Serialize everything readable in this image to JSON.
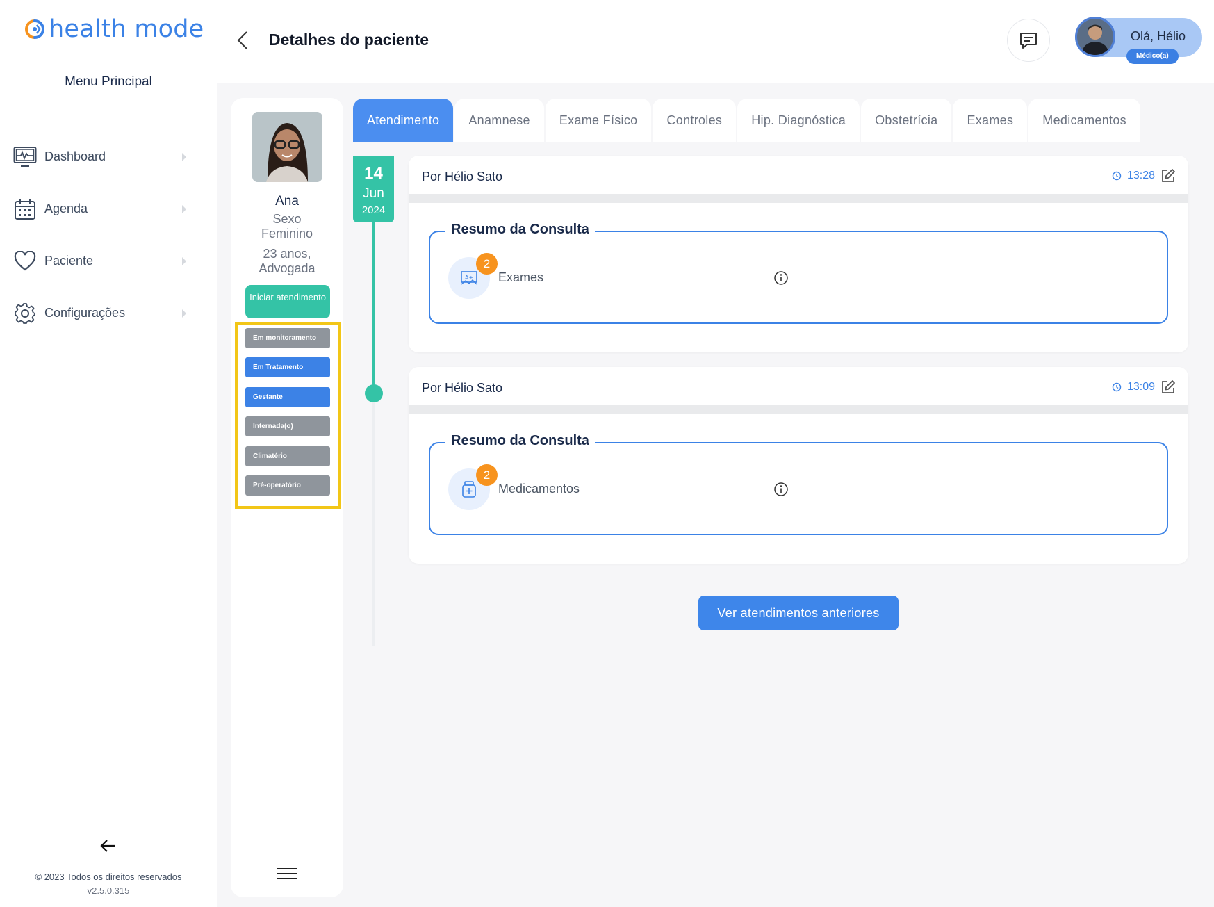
{
  "brand": {
    "logo_text": "health mode",
    "accent": "#3b82e6",
    "teal": "#34c3a6",
    "highlight": "#f2c617"
  },
  "sidebar": {
    "menu_title": "Menu Principal",
    "items": [
      {
        "label": "Dashboard",
        "icon": "monitor-pulse-icon"
      },
      {
        "label": "Agenda",
        "icon": "calendar-icon"
      },
      {
        "label": "Paciente",
        "icon": "heart-icon"
      },
      {
        "label": "Configurações",
        "icon": "gear-icon"
      }
    ],
    "footer_copyright": "© 2023 Todos os direitos reservados",
    "footer_version": "v2.5.0.315"
  },
  "header": {
    "title": "Detalhes do paciente",
    "user_greeting": "Olá, Hélio",
    "user_role": "Médico(a)"
  },
  "patient": {
    "name": "Ana",
    "sex_label": "Sexo",
    "sex_value": "Feminino",
    "age": "23 anos,",
    "profession": "Advogada",
    "start_button": "Iniciar atendimento",
    "tags": [
      {
        "label": "Em monitoramento",
        "active": false
      },
      {
        "label": "Em Tratamento",
        "active": true
      },
      {
        "label": "Gestante",
        "active": true
      },
      {
        "label": "Internada(o)",
        "active": false
      },
      {
        "label": "Climatério",
        "active": false
      },
      {
        "label": "Pré-operatório",
        "active": false
      }
    ]
  },
  "tabs": [
    {
      "label": "Atendimento",
      "active": true
    },
    {
      "label": "Anamnese",
      "active": false
    },
    {
      "label": "Exame Físico",
      "active": false
    },
    {
      "label": "Controles",
      "active": false
    },
    {
      "label": "Hip. Diagnóstica",
      "active": false
    },
    {
      "label": "Obstetrícia",
      "active": false
    },
    {
      "label": "Exames",
      "active": false
    },
    {
      "label": "Medicamentos",
      "active": false
    }
  ],
  "timeline": {
    "day": "14",
    "month": "Jun",
    "year": "2024"
  },
  "consultations": [
    {
      "author": "Por Hélio Sato",
      "time": "13:28",
      "summary_title": "Resumo da Consulta",
      "item_label": "Exames",
      "item_count": "2",
      "item_icon": "exam-report-icon"
    },
    {
      "author": "Por Hélio Sato",
      "time": "13:09",
      "summary_title": "Resumo da Consulta",
      "item_label": "Medicamentos",
      "item_count": "2",
      "item_icon": "medicine-bottle-icon"
    }
  ],
  "prev_button": "Ver atendimentos anteriores"
}
